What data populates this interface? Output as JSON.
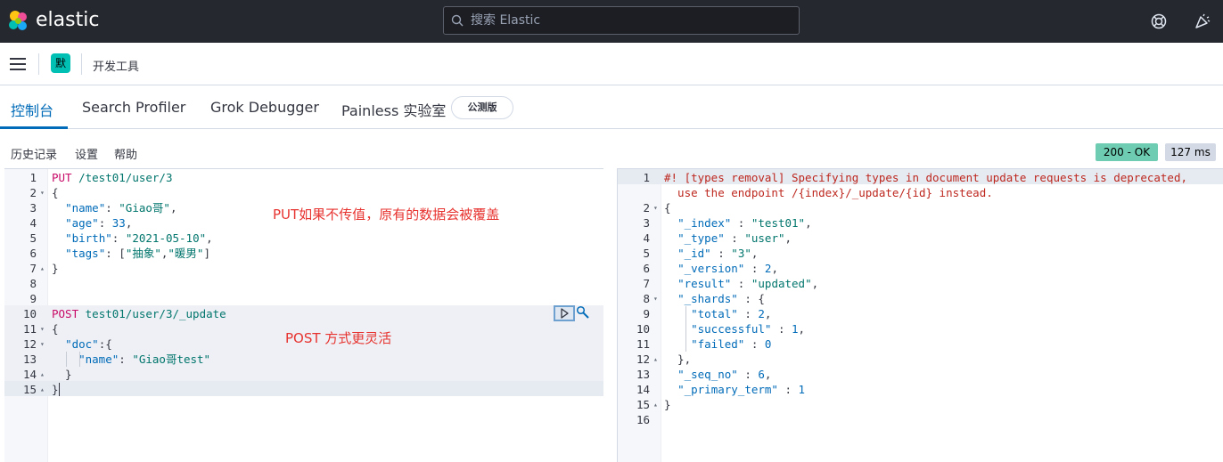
{
  "header": {
    "brand": "elastic",
    "search_placeholder": "搜索 Elastic",
    "icons": [
      "elastic-logo-icon",
      "search-icon",
      "help-icon",
      "newsfeed-icon"
    ]
  },
  "nav": {
    "space_initial": "默",
    "breadcrumb": "开发工具"
  },
  "tabs": [
    {
      "label": "控制台",
      "active": true
    },
    {
      "label": "Search Profiler",
      "active": false
    },
    {
      "label": "Grok Debugger",
      "active": false
    },
    {
      "label": "Painless 实验室",
      "active": false
    }
  ],
  "beta_badge": "公测版",
  "menu": [
    "历史记录",
    "设置",
    "帮助"
  ],
  "status": {
    "code": "200 - OK",
    "time": "127 ms"
  },
  "request_lines": [
    "PUT /test01/user/3",
    "{",
    "  \"name\": \"Giao哥\",",
    "  \"age\": 33,",
    "  \"birth\": \"2021-05-10\",",
    "  \"tags\": [\"抽象\",\"暖男\"]",
    "}",
    "",
    "",
    "POST test01/user/3/_update",
    "{",
    "  \"doc\":{",
    "    \"name\": \"Giao哥test\"",
    "  }",
    "}"
  ],
  "annotations": {
    "put_note": "PUT如果不传值，原有的数据会被覆盖",
    "post_note": "POST 方式更灵活"
  },
  "response_warning_1": "#! [types removal] Specifying types in document update requests is deprecated,",
  "response_warning_2": "  use the endpoint /{index}/_update/{id} instead.",
  "response_lines": [
    "{",
    "  \"_index\" : \"test01\",",
    "  \"_type\" : \"user\",",
    "  \"_id\" : \"3\",",
    "  \"_version\" : 2,",
    "  \"result\" : \"updated\",",
    "  \"_shards\" : {",
    "    \"total\" : 2,",
    "    \"successful\" : 1,",
    "    \"failed\" : 0",
    "  },",
    "  \"_seq_no\" : 6,",
    "  \"_primary_term\" : 1",
    "}",
    ""
  ],
  "colors": {
    "accent": "#006bb8",
    "header_bg": "#25282f",
    "status_ok": "#6dccb1",
    "annotation": "#e7332f"
  }
}
